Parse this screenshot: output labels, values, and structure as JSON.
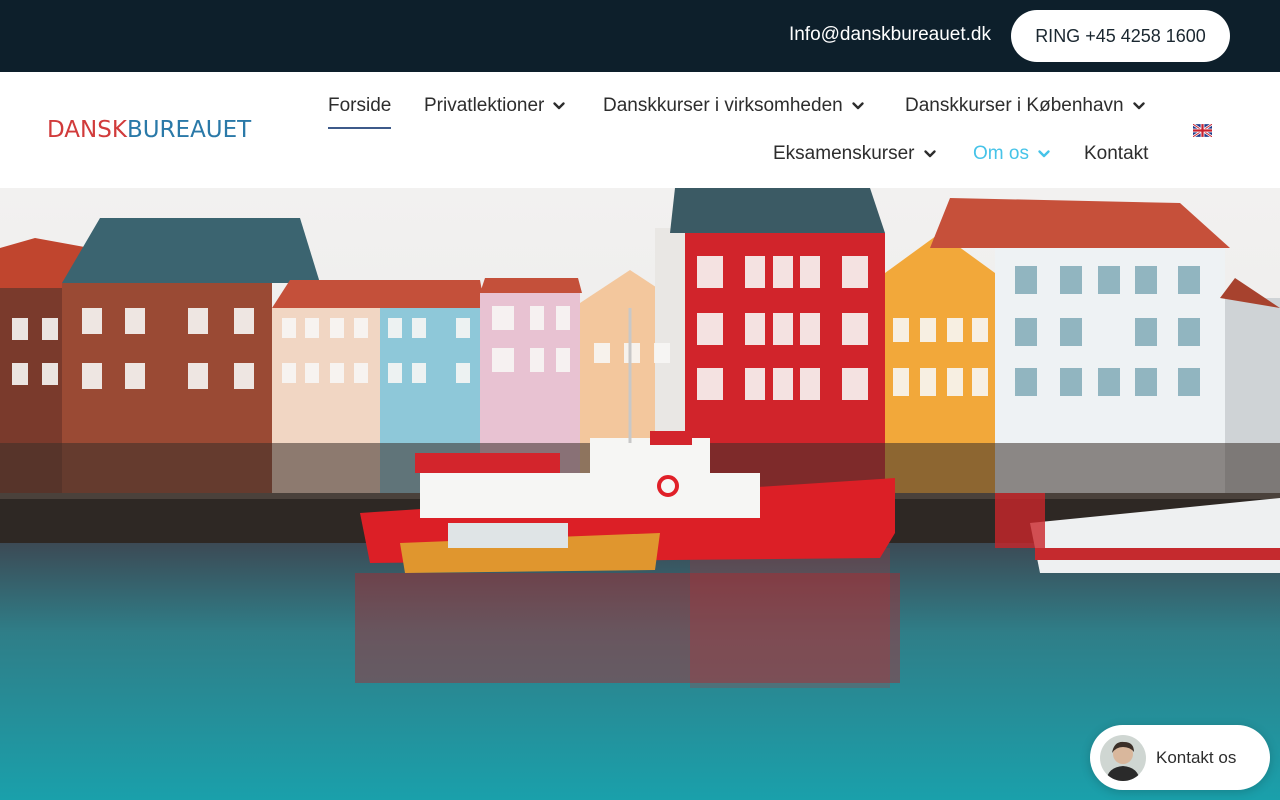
{
  "topbar": {
    "email": "Info@danskbureauet.dk",
    "call_button": "RING +45 4258 1600"
  },
  "header": {
    "logo_part1": "DANSK",
    "logo_part2": "BUREAUET",
    "nav": {
      "forside": "Forside",
      "privatlektioner": "Privatlektioner",
      "virksomheden": "Danskkurser i virksomheden",
      "kobenhavn": "Danskkurser i København",
      "eksamenskurser": "Eksamenskurser",
      "om_os": "Om os",
      "kontakt": "Kontakt"
    },
    "language_flag": "uk-flag-icon"
  },
  "chat": {
    "label": "Kontakt os"
  },
  "colors": {
    "topbar_bg": "#0d1f2b",
    "logo_red": "#d13b3b",
    "logo_blue": "#2a79a8",
    "nav_highlight": "#46c3e8",
    "active_underline": "#3d5a8a"
  }
}
